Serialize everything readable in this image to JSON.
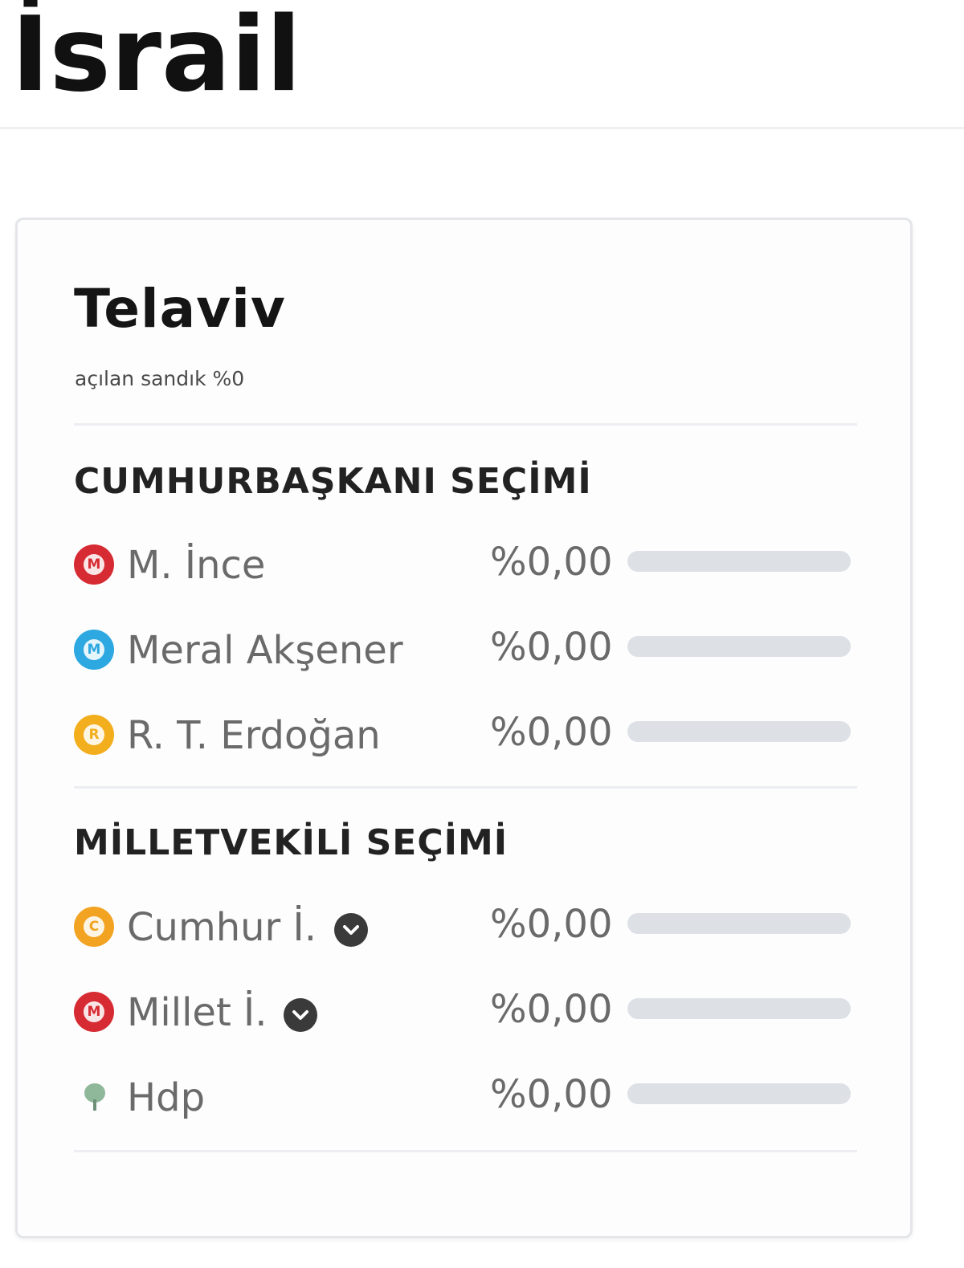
{
  "page": {
    "title": "İsrail"
  },
  "card": {
    "city": "Telaviv",
    "opened_box_text": "açılan sandık %0",
    "sections": [
      {
        "title": "CUMHURBAŞKANI SEÇİMİ",
        "rows": [
          {
            "name": "M. İnce",
            "badge_letter": "M",
            "badge_color": "#d62b33",
            "pct_text": "%0,00",
            "value": 0,
            "bar_color": "#d62b33",
            "has_chevron": false
          },
          {
            "name": "Meral Akşener",
            "badge_letter": "M",
            "badge_color": "#2ea8e0",
            "pct_text": "%0,00",
            "value": 0,
            "bar_color": "#2ea8e0",
            "has_chevron": false
          },
          {
            "name": "R. T. Erdoğan",
            "badge_letter": "R",
            "badge_color": "#f2ae1c",
            "pct_text": "%0,00",
            "value": 0,
            "bar_color": "#f2ae1c",
            "has_chevron": false
          }
        ]
      },
      {
        "title": "MİLLETVEKİLİ SEÇİMİ",
        "rows": [
          {
            "name": "Cumhur İ.",
            "badge_letter": "C",
            "badge_color": "#f2a321",
            "pct_text": "%0,00",
            "value": 0,
            "bar_color": "#f2a321",
            "has_chevron": true
          },
          {
            "name": "Millet İ.",
            "badge_letter": "M",
            "badge_color": "#d62b33",
            "pct_text": "%0,00",
            "value": 0,
            "bar_color": "#d62b33",
            "has_chevron": true
          },
          {
            "name": "Hdp",
            "badge_letter": "",
            "badge_color": "#8fb89a",
            "pct_text": "%0,00",
            "value": 0,
            "bar_color": "#8fb89a",
            "has_chevron": false,
            "icon": "hdp-tree-icon"
          }
        ]
      }
    ]
  },
  "colors": {
    "bar_track": "#dde1e6",
    "text_muted": "#6a6a6a",
    "heading": "#222222"
  }
}
